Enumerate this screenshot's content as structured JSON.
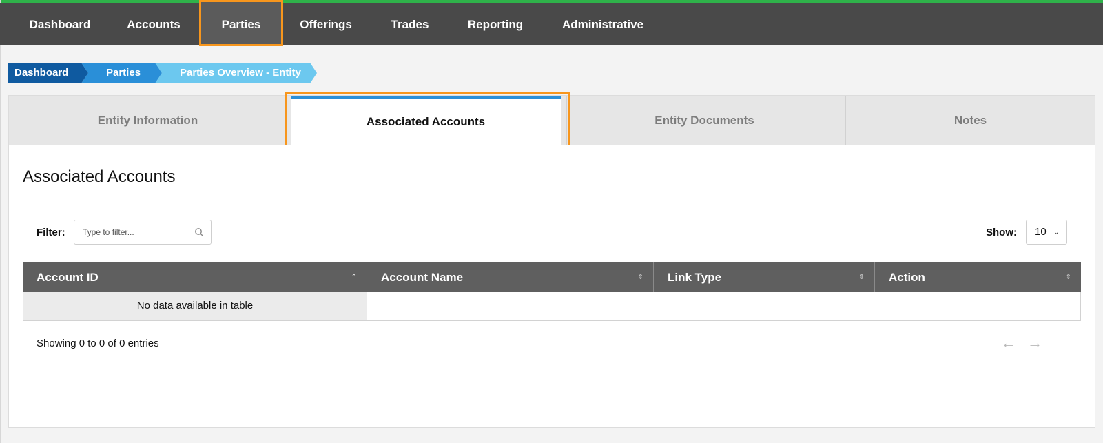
{
  "nav": {
    "items": [
      {
        "label": "Dashboard"
      },
      {
        "label": "Accounts"
      },
      {
        "label": "Parties"
      },
      {
        "label": "Offerings"
      },
      {
        "label": "Trades"
      },
      {
        "label": "Reporting"
      },
      {
        "label": "Administrative"
      }
    ],
    "active": "Parties"
  },
  "breadcrumb": [
    {
      "label": "Dashboard",
      "color": "#0f5aa0"
    },
    {
      "label": "Parties",
      "color": "#2a8fd8"
    },
    {
      "label": "Parties Overview - Entity",
      "color": "#6cc8ef"
    }
  ],
  "tabs": [
    {
      "label": "Entity Information"
    },
    {
      "label": "Associated Accounts"
    },
    {
      "label": "Entity Documents"
    },
    {
      "label": "Notes"
    }
  ],
  "active_tab": "Associated Accounts",
  "section": {
    "title": "Associated Accounts"
  },
  "filter": {
    "label": "Filter:",
    "placeholder": "Type to filter...",
    "value": ""
  },
  "show": {
    "label": "Show:",
    "value": "10"
  },
  "table": {
    "columns": [
      "Account ID",
      "Account Name",
      "Link Type",
      "Action"
    ],
    "empty_message": "No data available in table"
  },
  "footer": {
    "info": "Showing 0 to 0 of 0 entries",
    "prev": "←",
    "next": "→"
  },
  "colors": {
    "accent": "#2a8fd8",
    "highlight": "#f7961d",
    "nav_bg": "#494949",
    "header_bg": "#5f5f5f"
  }
}
